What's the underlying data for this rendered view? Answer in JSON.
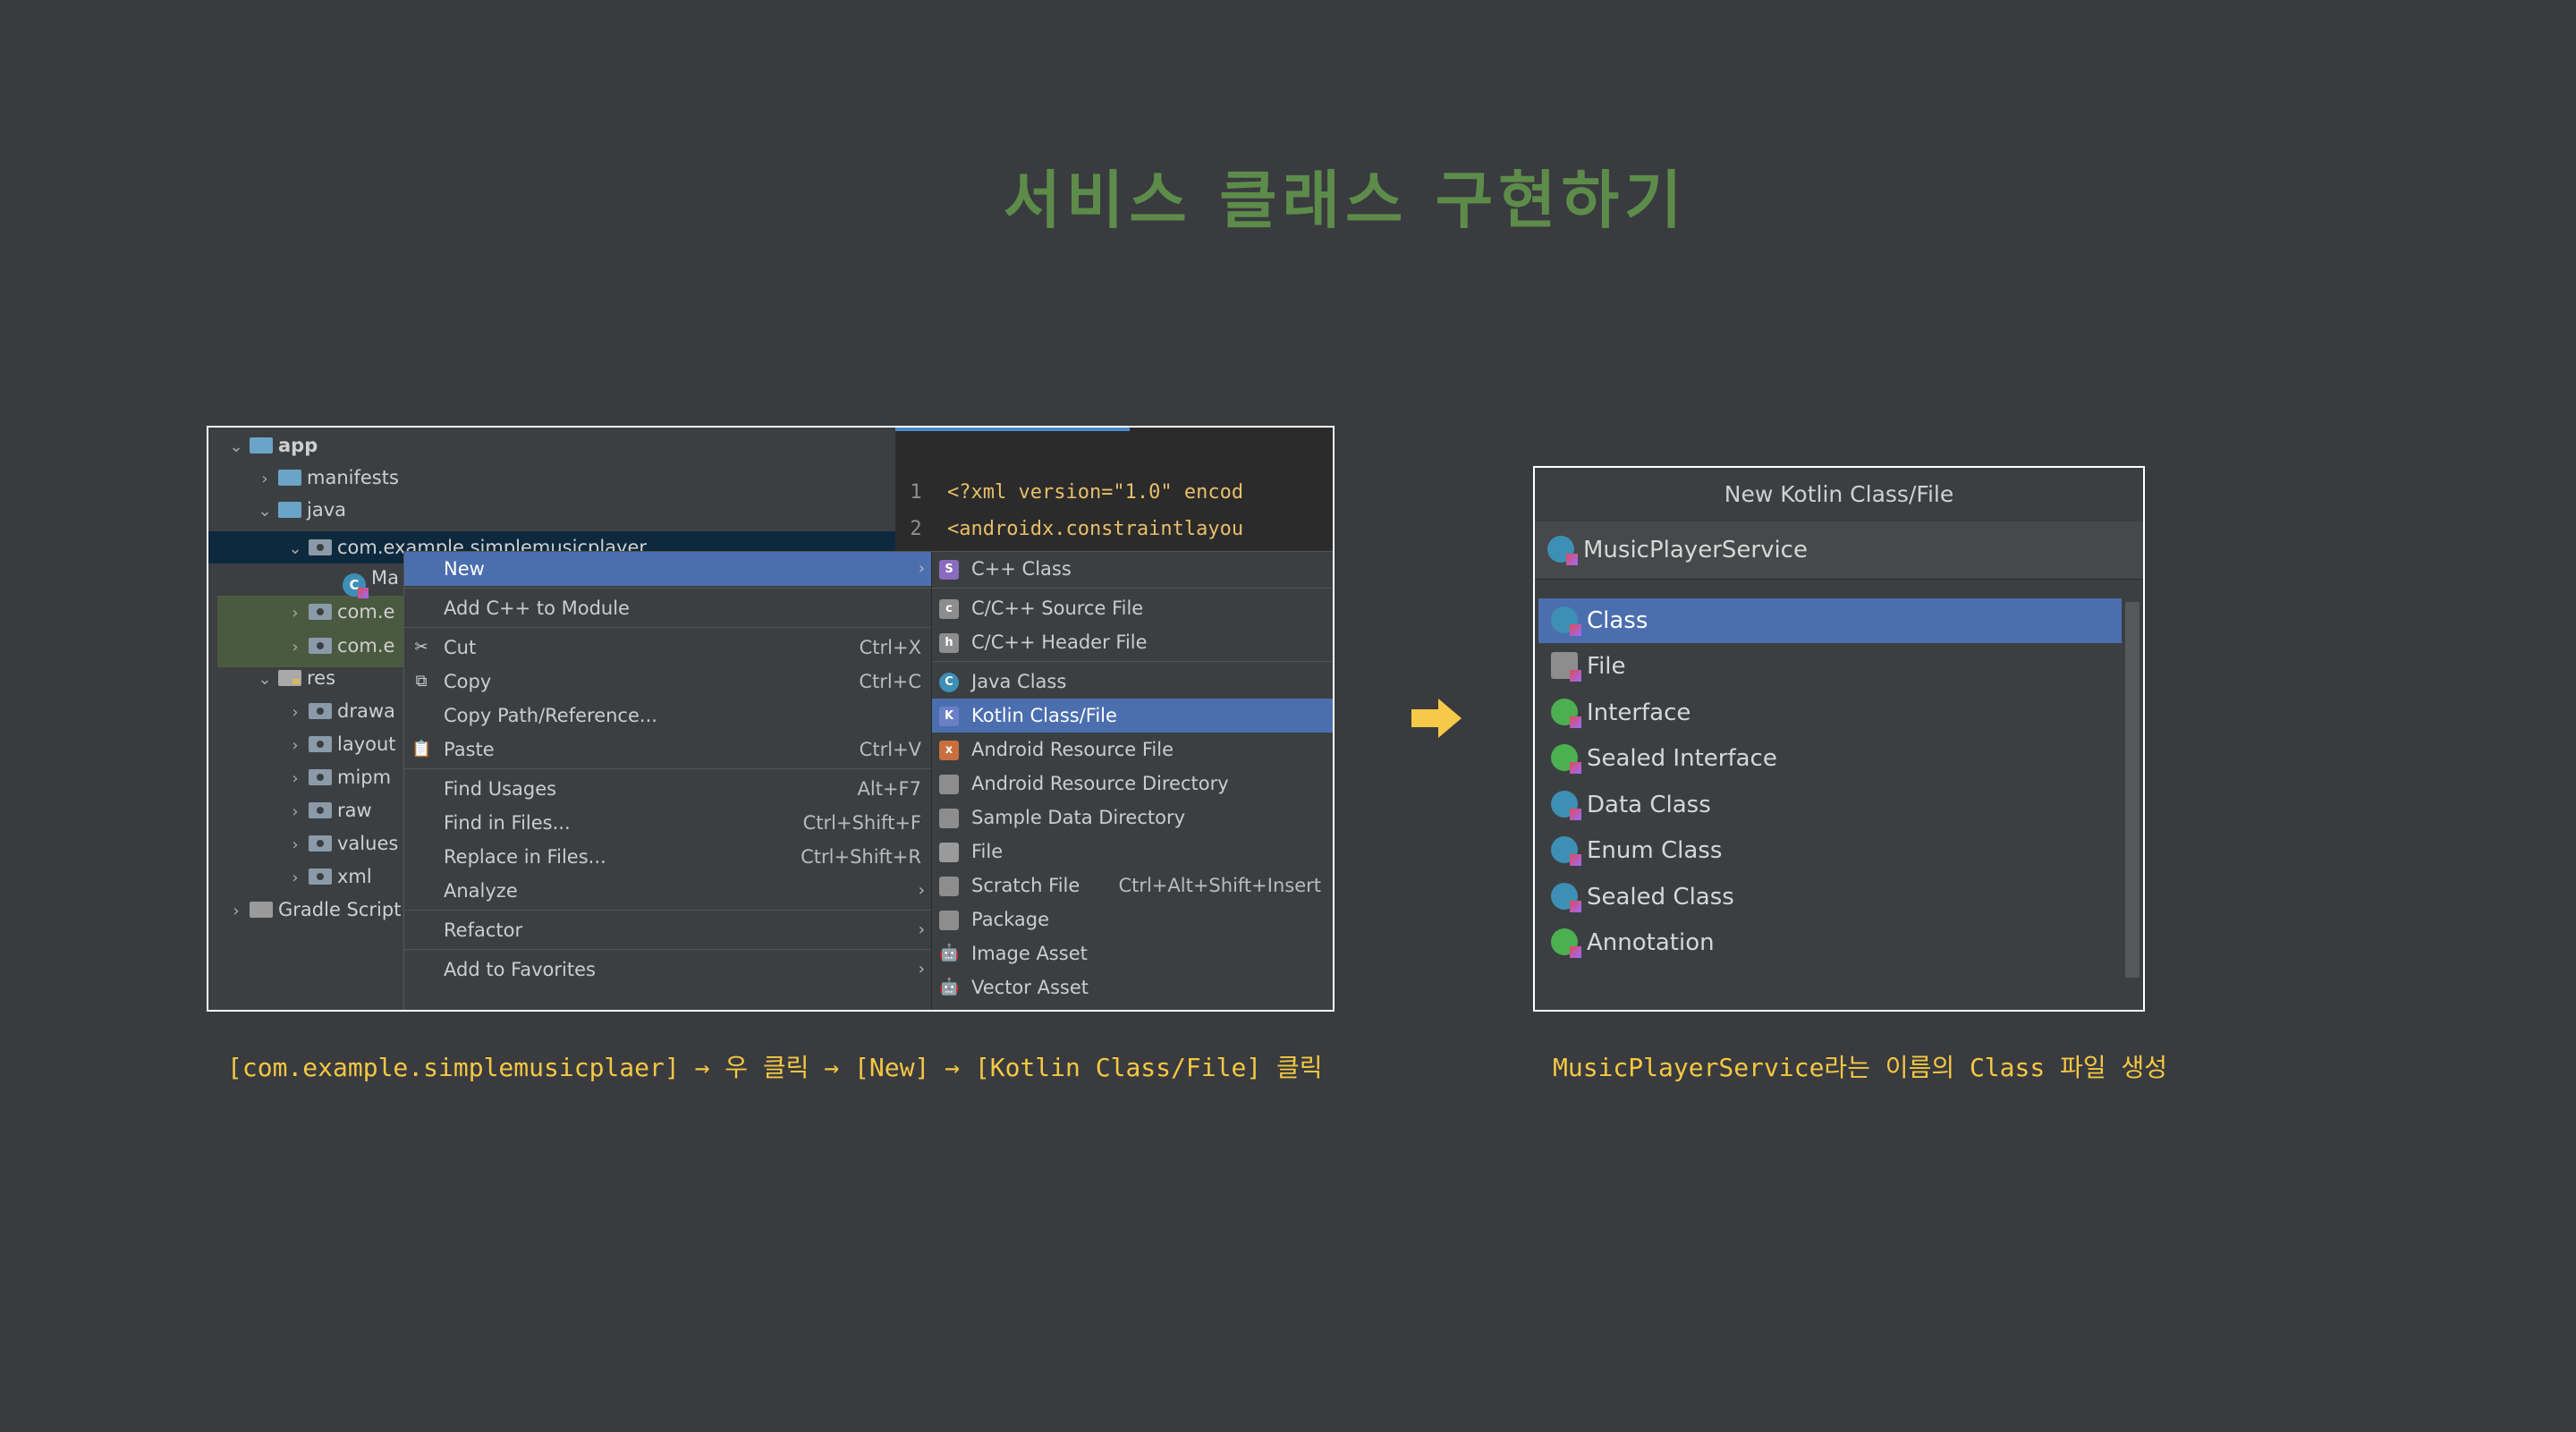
{
  "slide": {
    "title": "서비스 클래스 구현하기",
    "caption_left": "[com.example.simplemusicplaer] → 우 클릭 → [New] → [Kotlin Class/File] 클릭",
    "caption_right": "MusicPlayerService라는 이름의 Class 파일 생성"
  },
  "tree": {
    "app": "app",
    "manifests": "manifests",
    "java": "java",
    "package": "com.example.simplemusicplayer",
    "main_file": "Ma",
    "pkg2": "com.e",
    "pkg3": "com.e",
    "res": "res",
    "drawable": "drawa",
    "layout": "layout",
    "mipmap": "mipm",
    "raw": "raw",
    "values": "values",
    "xml": "xml",
    "gradle": "Gradle Script"
  },
  "editor": {
    "line1_num": "1",
    "line1_text": "<?xml version=\"1.0\" encod",
    "line2_num": "2",
    "line2_text": "<androidx.constraintlayou"
  },
  "context_menu": {
    "new": "New",
    "add_cpp": "Add C++ to Module",
    "cut": "Cut",
    "cut_sc": "Ctrl+X",
    "copy": "Copy",
    "copy_sc": "Ctrl+C",
    "copy_path": "Copy Path/Reference...",
    "paste": "Paste",
    "paste_sc": "Ctrl+V",
    "find_usages": "Find Usages",
    "find_usages_sc": "Alt+F7",
    "find_files": "Find in Files...",
    "find_files_sc": "Ctrl+Shift+F",
    "replace_files": "Replace in Files...",
    "replace_files_sc": "Ctrl+Shift+R",
    "analyze": "Analyze",
    "refactor": "Refactor",
    "favorites": "Add to Favorites"
  },
  "submenu": {
    "cpp_class": "C++ Class",
    "cpp_source": "C/C++ Source File",
    "cpp_header": "C/C++ Header File",
    "java_class": "Java Class",
    "kotlin": "Kotlin Class/File",
    "android_res_file": "Android Resource File",
    "android_res_dir": "Android Resource Directory",
    "sample_data": "Sample Data Directory",
    "file": "File",
    "scratch": "Scratch File",
    "scratch_sc": "Ctrl+Alt+Shift+Insert",
    "package": "Package",
    "image_asset": "Image Asset",
    "vector_asset": "Vector Asset"
  },
  "dialog": {
    "title": "New Kotlin Class/File",
    "input_value": "MusicPlayerService",
    "items": [
      "Class",
      "File",
      "Interface",
      "Sealed Interface",
      "Data Class",
      "Enum Class",
      "Sealed Class",
      "Annotation"
    ]
  },
  "colors": {
    "selection": "#4b6eaf",
    "title_green": "#5d8c4a",
    "caption_yellow": "#f5c842",
    "arrow": "#f7c948"
  }
}
